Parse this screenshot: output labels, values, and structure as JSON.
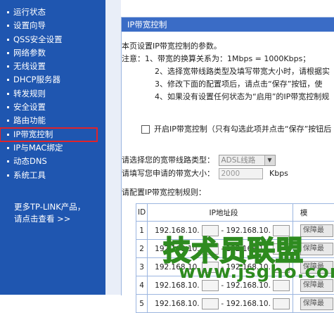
{
  "sidebar": {
    "items": [
      {
        "label": "运行状态"
      },
      {
        "label": "设置向导"
      },
      {
        "label": "QSS安全设置"
      },
      {
        "label": "网络参数"
      },
      {
        "label": "无线设置"
      },
      {
        "label": "DHCP服务器"
      },
      {
        "label": "转发规则"
      },
      {
        "label": "安全设置"
      },
      {
        "label": "路由功能"
      },
      {
        "label": "IP带宽控制"
      },
      {
        "label": "IP与MAC绑定"
      },
      {
        "label": "动态DNS"
      },
      {
        "label": "系统工具"
      }
    ],
    "more_line1": "更多TP-LINK产品，",
    "more_line2": "请点击查看 >>"
  },
  "panel": {
    "title": "IP带宽控制",
    "desc": {
      "line0": "本页设置IP带宽控制的参数。",
      "note": "注意：1、带宽的换算关系为：1Mbps = 1000Kbps；",
      "n2": "2、选择宽带线路类型及填写带宽大小时，请根据实",
      "n3": "3、修改下面的配置项后，请点击“保存”按钮，使",
      "n4": "4、如果没有设置任何状态为“启用”的IP带宽控制规"
    },
    "enable_label": "开启IP带宽控制（只有勾选此项并点击“保存”按钮后",
    "line_type_label": "请选择您的宽带线路类型：",
    "line_type_value": "ADSL线路",
    "bandwidth_label": "请填写您申请的带宽大小：",
    "bandwidth_value": "2000",
    "bandwidth_unit": "Kbps",
    "rules_title": "请配置IP带宽控制规则：",
    "table": {
      "col_id": "ID",
      "col_ip": "IP地址段",
      "col_more": "模",
      "rows": [
        {
          "id": "1",
          "ip_start": "192.168.10.",
          "sep": "-",
          "ip_end": "192.168.10.",
          "mode": "保障最"
        },
        {
          "id": "2",
          "ip_start": "192.168.10.",
          "sep": "-",
          "ip_end": "192.168.10.",
          "mode": "保障最"
        },
        {
          "id": "3",
          "ip_start": "192.168.10.",
          "sep": "-",
          "ip_end": "192.168.10.",
          "mode": "保障最"
        },
        {
          "id": "4",
          "ip_start": "192.168.10.",
          "sep": "-",
          "ip_end": "192.168.10.",
          "mode": "保障最"
        },
        {
          "id": "5",
          "ip_start": "192.168.10.",
          "sep": "-",
          "ip_end": "192.168.10.",
          "mode": "保障最"
        }
      ]
    }
  },
  "watermark": {
    "line1": "技术员联盟",
    "line2": "www.jsgho.com"
  },
  "colors": {
    "sidebar": "#1f56b0",
    "header": "#3a6cc6",
    "highlight": "#e0232a",
    "watermark": "#2e8b1f"
  }
}
